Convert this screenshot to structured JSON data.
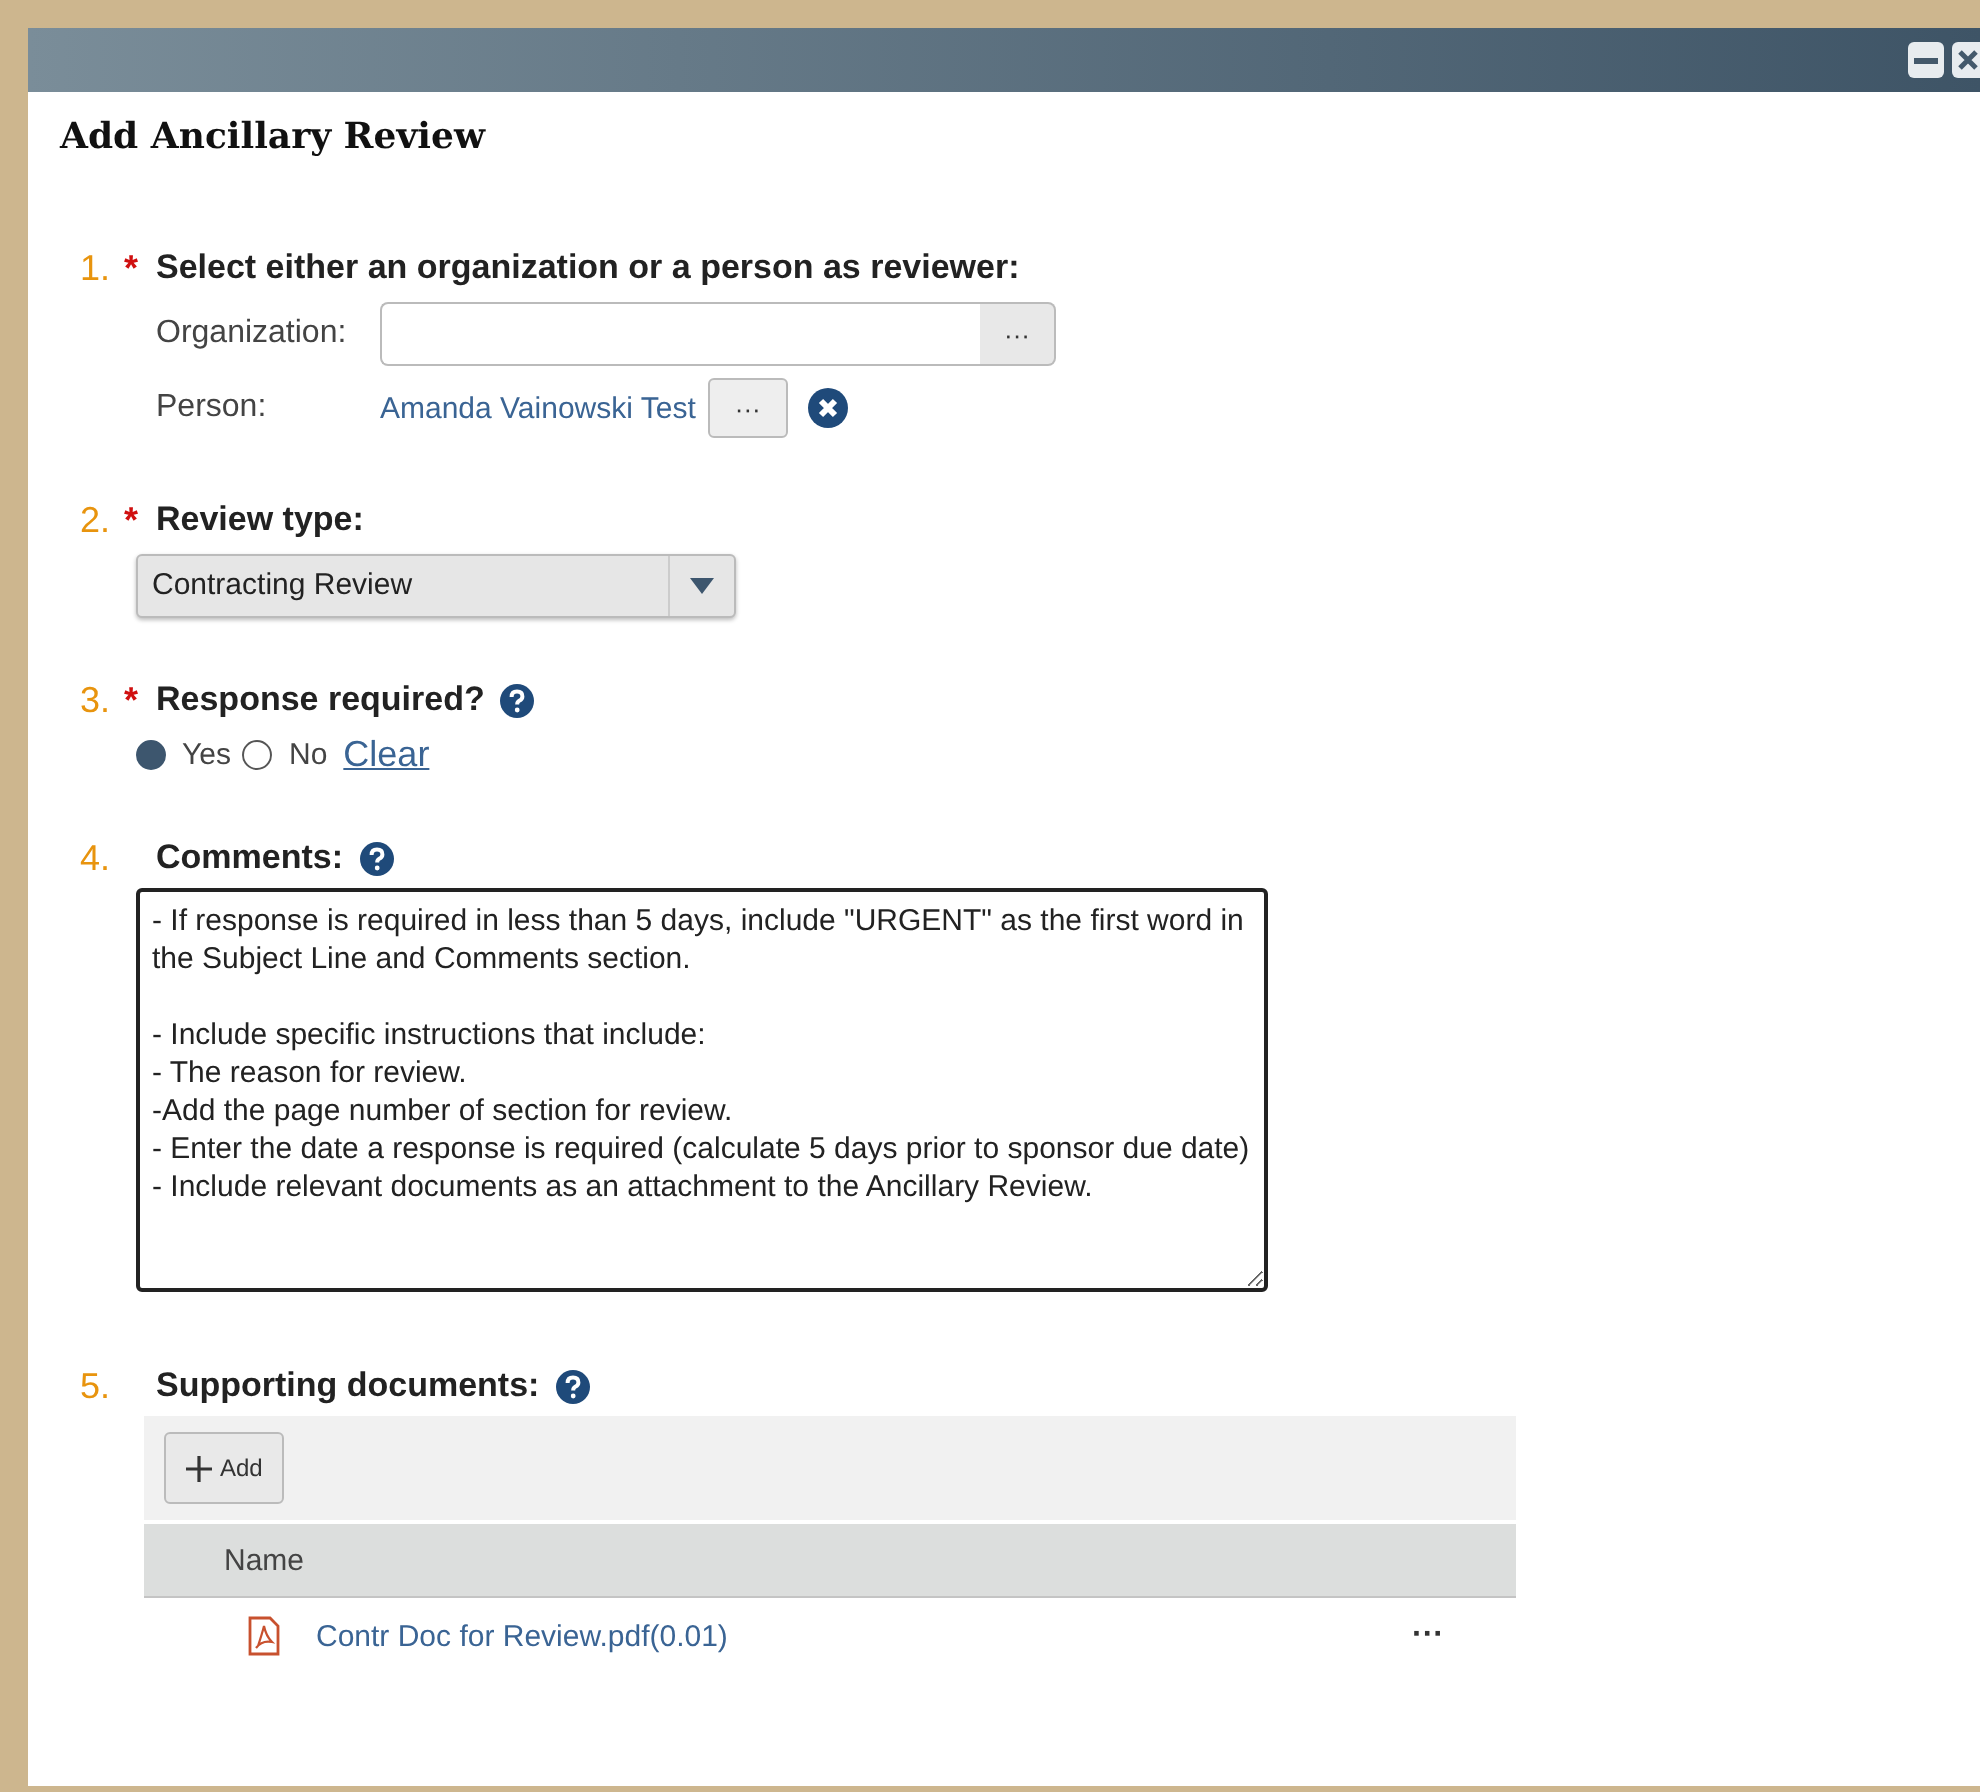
{
  "window": {
    "title": "Add Ancillary Review"
  },
  "sections": [
    {
      "kind": "reviewer",
      "number": "1.",
      "required_mark": "*",
      "label": "Select either an organization or a person as reviewer:",
      "organization": {
        "label": "Organization:",
        "button": "···"
      },
      "person": {
        "label": "Person:",
        "value": "Amanda Vainowski Test",
        "button": "···"
      }
    },
    {
      "kind": "select",
      "number": "2.",
      "required_mark": "*",
      "label": "Review type:",
      "value": "Contracting Review"
    },
    {
      "kind": "radio",
      "number": "3.",
      "required_mark": "*",
      "label": "Response required?",
      "help": true,
      "options": [
        {
          "label": "Yes",
          "selected": true
        },
        {
          "label": "No",
          "selected": false
        }
      ],
      "clear": "Clear"
    },
    {
      "kind": "textarea",
      "number": "4.",
      "label": "Comments:",
      "help": true,
      "value": "- If response is required in less than 5 days, include \"URGENT\" as the first word in the Subject Line and Comments section.\n\n- Include specific instructions that include:\n- The reason for review.\n-Add the page number of section for review.\n- Enter the date a response is required (calculate 5 days prior to sponsor due date)\n- Include relevant documents as an attachment to the Ancillary Review."
    },
    {
      "kind": "documents",
      "number": "5.",
      "label": "Supporting documents:",
      "help": true,
      "add_button": "Add",
      "column": "Name",
      "rows": [
        {
          "name": "Contr Doc for Review.pdf(0.01)",
          "menu": "···"
        }
      ]
    }
  ]
}
